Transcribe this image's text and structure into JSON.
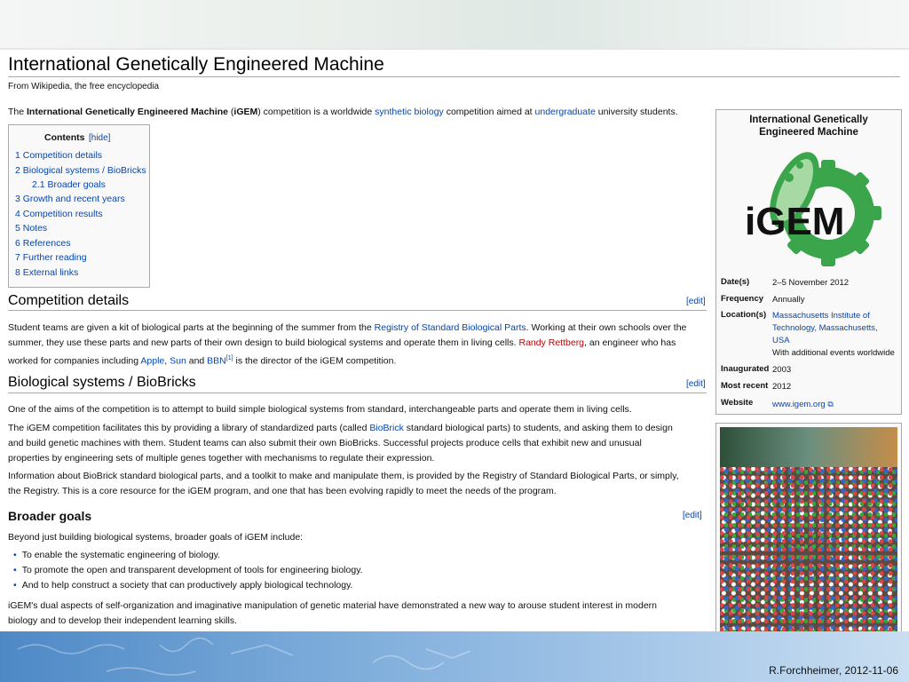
{
  "wiki": {
    "title": "International Genetically Engineered Machine",
    "tagline": "From Wikipedia, the free encyclopedia",
    "intro": {
      "t1": "The ",
      "b1": "International Genetically Engineered Machine",
      "t2": " (",
      "b2": "iGEM",
      "t3": ") competition is a worldwide ",
      "l1": "synthetic biology",
      "t4": " competition aimed at ",
      "l2": "undergraduate",
      "t5": " university students."
    },
    "toc": {
      "heading": "Contents",
      "hide": "[hide]",
      "items": [
        "1 Competition details",
        "2 Biological systems / BioBricks",
        "2.1 Broader goals",
        "3 Growth and recent years",
        "4 Competition results",
        "5 Notes",
        "6 References",
        "7 Further reading",
        "8 External links"
      ]
    },
    "edit_label": "[edit]",
    "section1": {
      "heading": "Competition details",
      "l1_a": "Student teams are given a kit of biological parts at the beginning of the summer from the ",
      "l1_link": "Registry of Standard Biological Parts",
      "l1_b": ". Working at their own schools over the",
      "l2_a": "summer, they use these parts and new parts of their own design to build biological systems and operate them in living cells. ",
      "l2_red": "Randy Rettberg",
      "l2_b": ", an engineer who has",
      "l3_a": "worked for companies including ",
      "l3_apple": "Apple",
      "l3_comma": ", ",
      "l3_sun": "Sun",
      "l3_and": " and ",
      "l3_bbn": "BBN",
      "l3_sup": "[1]",
      "l3_b": " is the director of the iGEM competition."
    },
    "section2": {
      "heading": "Biological systems / BioBricks",
      "p1": "One of the aims of the competition is to attempt to build simple biological systems from standard, interchangeable parts and operate them in living cells.",
      "p2_l1_a": "The iGEM competition facilitates this by providing a library of standardized parts (called ",
      "p2_l1_link": "BioBrick",
      "p2_l1_b": " standard biological parts) to students, and asking them to design",
      "p2_l2": "and build genetic machines with them. Student teams can also submit their own BioBricks. Successful projects produce cells that exhibit new and unusual",
      "p2_l3": "properties by engineering sets of multiple genes together with mechanisms to regulate their expression.",
      "p3_l1": "Information about BioBrick standard biological parts, and a toolkit to make and manipulate them, is provided by the Registry of Standard Biological Parts, or simply,",
      "p3_l2": "the Registry. This is a core resource for the iGEM program, and one that has been evolving rapidly to meet the needs of the program."
    },
    "section3": {
      "heading": "Broader goals",
      "intro": "Beyond just building biological systems, broader goals of iGEM include:",
      "bullets": [
        "To enable the systematic engineering of biology.",
        "To promote the open and transparent development of tools for engineering biology.",
        "And to help construct a society that can productively apply biological technology."
      ],
      "closing_l1": "iGEM's dual aspects of self-organization and imaginative manipulation of genetic material have demonstrated a new way to arouse student interest in modern",
      "closing_l2": "biology and to develop their independent learning skills."
    }
  },
  "infobox": {
    "title_l1": "International Genetically",
    "title_l2": "Engineered Machine",
    "logo_text": "iGEM",
    "rows": {
      "dates_label": "Date(s)",
      "dates_val": "2–5 November 2012",
      "freq_label": "Frequency",
      "freq_val": "Annually",
      "loc_label": "Location(s)",
      "loc_l1": "Massachusetts Institute of",
      "loc_l2": "Technology, Massachusetts,",
      "loc_l3": "USA",
      "loc_l4": "With additional events worldwide",
      "inaug_label": "Inaugurated",
      "inaug_val": "2003",
      "recent_label": "Most recent",
      "recent_val": "2012",
      "web_label": "Website",
      "web_val": "www.igem.org"
    }
  },
  "footer": {
    "credit": "R.Forchheimer, 2012-11-06"
  },
  "colors": {
    "link": "#0645ad",
    "redlink": "#ba0000",
    "logo_green": "#3aa54a"
  }
}
